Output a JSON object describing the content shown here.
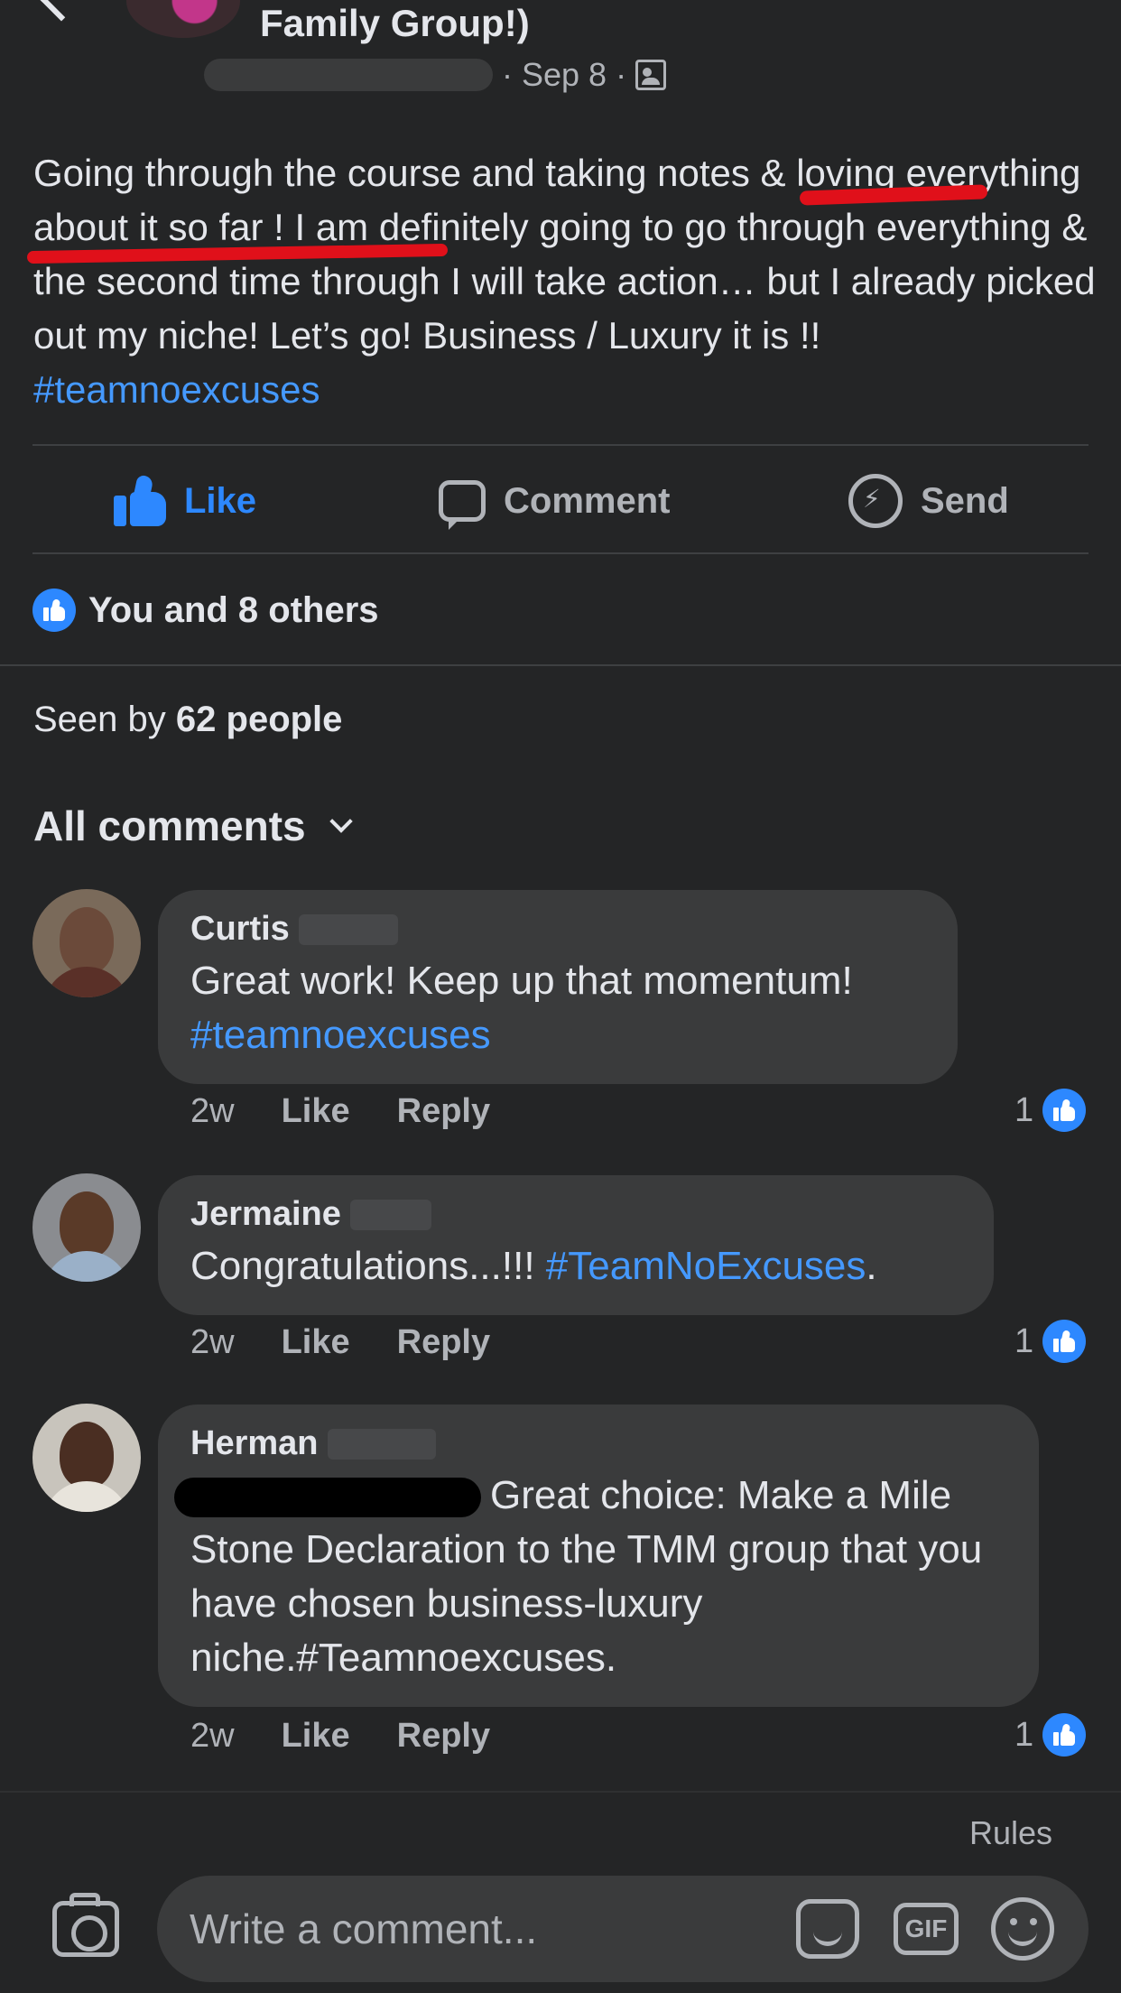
{
  "header": {
    "group_title": "Family Group!)",
    "date": "Sep 8",
    "separator": "·"
  },
  "post": {
    "text": "Going through the course and taking notes & loving everything about it so far ! I am definitely going to go through everything & the second time through I will take action… but I already picked out my niche! Let’s go! Business / Luxury it is !!",
    "hashtag": "#teamnoexcuses"
  },
  "actions": {
    "like_label": "Like",
    "comment_label": "Comment",
    "send_label": "Send"
  },
  "reactions": {
    "summary": "You and 8 others"
  },
  "seen": {
    "prefix": "Seen by",
    "count": "62 people"
  },
  "comments_header": {
    "label": "All comments"
  },
  "comments": [
    {
      "name": "Curtis",
      "text": "Great work! Keep up that momentum!",
      "hashtag": "#teamnoexcuses",
      "time": "2w",
      "like": "Like",
      "reply": "Reply",
      "likes": "1"
    },
    {
      "name": "Jermaine",
      "text": "Congratulations...!!!",
      "hashtag": "#TeamNoExcuses",
      "trailing": ".",
      "time": "2w",
      "like": "Like",
      "reply": "Reply",
      "likes": "1"
    },
    {
      "name": "Herman",
      "text": "Great choice: Make a Mile Stone Declaration to the TMM group that you have chosen business-luxury niche.#Teamnoexcuses.",
      "time": "2w",
      "like": "Like",
      "reply": "Reply",
      "likes": "1"
    }
  ],
  "composer": {
    "rules": "Rules",
    "placeholder": "Write a comment...",
    "gif_label": "GIF"
  },
  "colors": {
    "background": "#242526",
    "bubble": "#3a3b3c",
    "accent": "#2d88ff",
    "hashtag": "#4599ff",
    "annotation_underline": "#e0101a"
  },
  "icons": [
    "back-chevron-icon",
    "privacy-icon",
    "like-icon",
    "comment-icon",
    "messenger-icon",
    "like-badge-icon",
    "chevron-down-icon",
    "camera-icon",
    "sticker-icon",
    "gif-icon",
    "emoji-icon"
  ]
}
